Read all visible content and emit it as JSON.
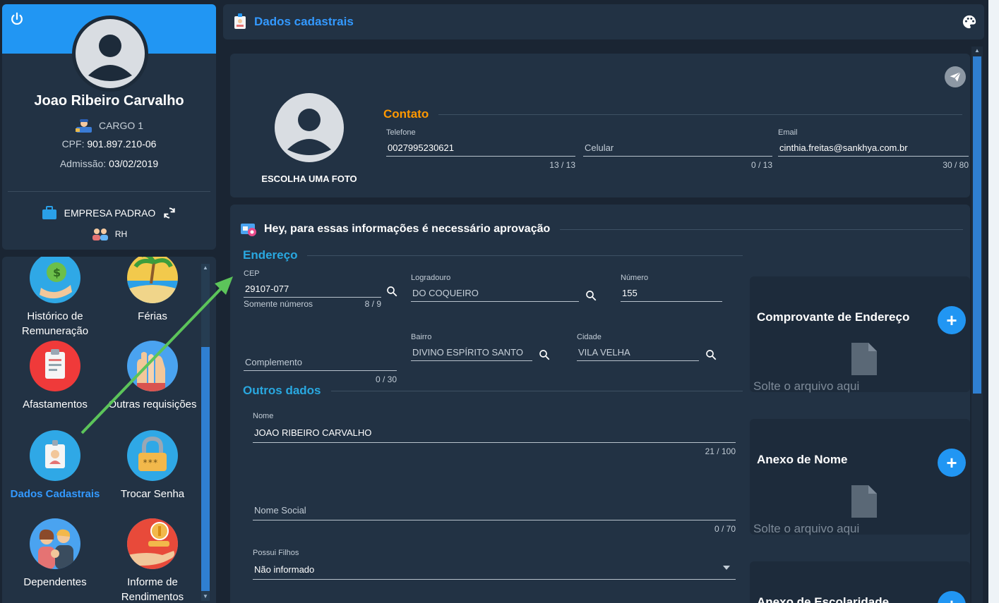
{
  "profile": {
    "name": "Joao Ribeiro Carvalho",
    "cargo": "CARGO 1",
    "cpf_label": "CPF:",
    "cpf_value": "901.897.210-06",
    "admissao_label": "Admissão:",
    "admissao_value": "03/02/2019",
    "company": "EMPRESA PADRAO",
    "department": "RH"
  },
  "menu": {
    "items": [
      {
        "label": "Histórico de Remuneração"
      },
      {
        "label": "Férias"
      },
      {
        "label": "Afastamentos"
      },
      {
        "label": "Outras requisições"
      },
      {
        "label": "Dados Cadastrais"
      },
      {
        "label": "Trocar Senha"
      },
      {
        "label": "Dependentes"
      },
      {
        "label": "Informe de Rendimentos"
      }
    ]
  },
  "header": {
    "title": "Dados cadastrais"
  },
  "contact": {
    "photo_label": "ESCOLHA UMA FOTO",
    "section_title": "Contato",
    "telefone": {
      "label": "Telefone",
      "value": "0027995230621",
      "counter": "13 / 13"
    },
    "celular": {
      "placeholder": "Celular",
      "counter": "0 / 13"
    },
    "email": {
      "label": "Email",
      "value": "cinthia.freitas@sankhya.com.br",
      "counter": "30 / 80"
    }
  },
  "approval": {
    "title": "Hey, para essas informações é necessário aprovação",
    "endereco": {
      "section_title": "Endereço",
      "cep": {
        "label": "CEP",
        "value": "29107-077",
        "hint": "Somente números",
        "counter": "8 / 9"
      },
      "logradouro": {
        "label": "Logradouro",
        "value": "DO COQUEIRO"
      },
      "numero": {
        "label": "Número",
        "value": "155"
      },
      "complemento": {
        "placeholder": "Complemento",
        "counter": "0 / 30"
      },
      "bairro": {
        "label": "Bairro",
        "value": "DIVINO ESPÍRITO SANTO"
      },
      "cidade": {
        "label": "Cidade",
        "value": "VILA VELHA"
      }
    },
    "outros": {
      "section_title": "Outros dados",
      "nome": {
        "label": "Nome",
        "value": "JOAO RIBEIRO CARVALHO",
        "counter": "21 / 100"
      },
      "nome_social": {
        "placeholder": "Nome Social",
        "counter": "0 / 70"
      },
      "possui_filhos": {
        "label": "Possui Filhos",
        "value": "Não informado"
      }
    },
    "attachments": [
      {
        "title": "Comprovante de Endereço",
        "add": "+",
        "drop": "Solte o arquivo aqui"
      },
      {
        "title": "Anexo de Nome",
        "add": "+",
        "drop": "Solte o arquivo aqui"
      },
      {
        "title": "Anexo de Escolaridade",
        "add": "+"
      }
    ]
  },
  "colors": {
    "accent": "#2196f3",
    "link_active": "#3399ff",
    "contato": "#ff9800",
    "section": "#29a8e0",
    "annotation": "#5cc45a"
  }
}
